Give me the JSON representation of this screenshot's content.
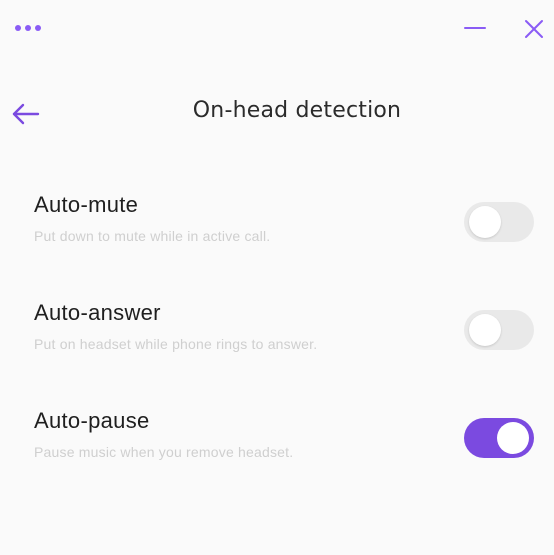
{
  "titlebar": {
    "menu_icon": "more-horizontal-icon",
    "minimize_icon": "minimize-icon",
    "close_icon": "close-icon"
  },
  "header": {
    "back_icon": "arrow-left-icon",
    "title": "On-head detection"
  },
  "colors": {
    "accent": "#7b4ae0",
    "toggle_off": "#e9e9e9",
    "description": "#cfcfcf",
    "label": "#1f1f1f"
  },
  "settings": [
    {
      "label": "Auto-mute",
      "description": "Put down to mute while in active call.",
      "enabled": false
    },
    {
      "label": "Auto-answer",
      "description": "Put on headset while phone rings to answer.",
      "enabled": false
    },
    {
      "label": "Auto-pause",
      "description": "Pause music when you remove headset.",
      "enabled": true
    }
  ]
}
